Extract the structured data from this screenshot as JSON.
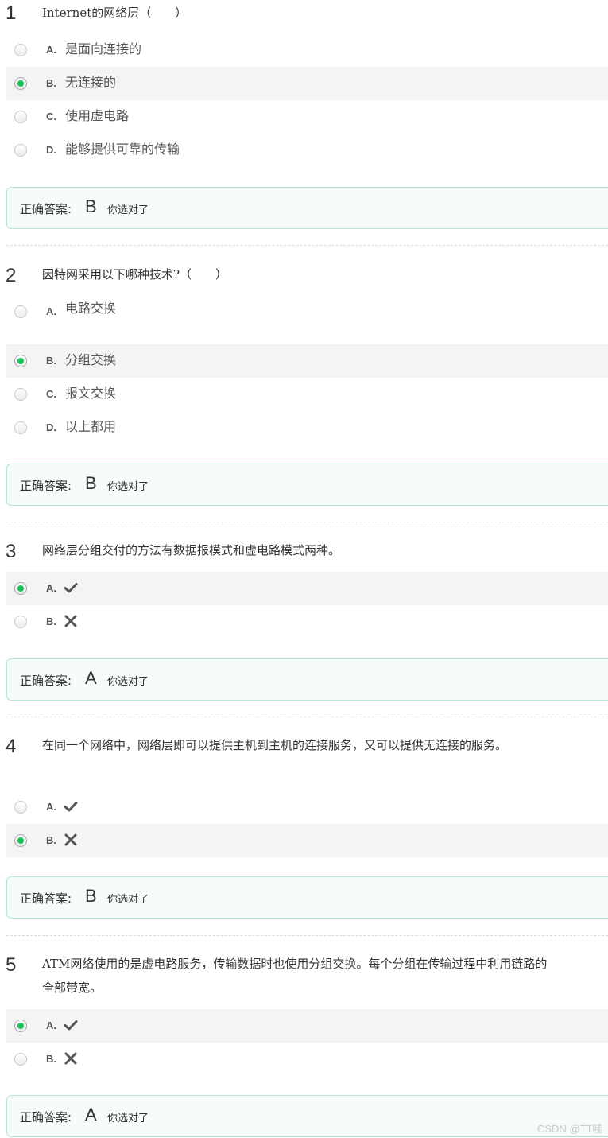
{
  "questions": [
    {
      "number": "1",
      "text": "Internet的网络层（　　）",
      "options": [
        {
          "letter": "A.",
          "text": "是面向连接的",
          "selected": false
        },
        {
          "letter": "B.",
          "text": "无连接的",
          "selected": true
        },
        {
          "letter": "C.",
          "text": "使用虚电路",
          "selected": false
        },
        {
          "letter": "D.",
          "text": "能够提供可靠的传输",
          "selected": false
        }
      ],
      "answer_label": "正确答案:",
      "answer_value": "B",
      "answer_note": "你选对了"
    },
    {
      "number": "2",
      "text": "因特网采用以下哪种技术?（　　）",
      "options": [
        {
          "letter": "A.",
          "text": "电路交换",
          "selected": false
        },
        {
          "letter": "B.",
          "text": "分组交换",
          "selected": true
        },
        {
          "letter": "C.",
          "text": "报文交换",
          "selected": false
        },
        {
          "letter": "D.",
          "text": "以上都用",
          "selected": false
        }
      ],
      "answer_label": "正确答案:",
      "answer_value": "B",
      "answer_note": "你选对了"
    },
    {
      "number": "3",
      "text": "网络层分组交付的方法有数据报模式和虚电路模式两种。",
      "options": [
        {
          "letter": "A.",
          "icon": "check-icon",
          "selected": true
        },
        {
          "letter": "B.",
          "icon": "cross-icon",
          "selected": false
        }
      ],
      "answer_label": "正确答案:",
      "answer_value": "A",
      "answer_note": "你选对了"
    },
    {
      "number": "4",
      "text": "在同一个网络中，网络层即可以提供主机到主机的连接服务，又可以提供无连接的服务。",
      "options": [
        {
          "letter": "A.",
          "icon": "check-icon",
          "selected": false
        },
        {
          "letter": "B.",
          "icon": "cross-icon",
          "selected": true
        }
      ],
      "answer_label": "正确答案:",
      "answer_value": "B",
      "answer_note": "你选对了"
    },
    {
      "number": "5",
      "text": "ATM网络使用的是虚电路服务，传输数据时也使用分组交换。每个分组在传输过程中利用链路的全部带宽。",
      "options": [
        {
          "letter": "A.",
          "icon": "check-icon",
          "selected": true
        },
        {
          "letter": "B.",
          "icon": "cross-icon",
          "selected": false
        }
      ],
      "answer_label": "正确答案:",
      "answer_value": "A",
      "answer_note": "你选对了"
    }
  ],
  "watermark": "CSDN @TT哇",
  "colors": {
    "selected_radio": "#19c359",
    "answer_border": "#b6e6cf",
    "answer_bg": "#f5fcf9"
  }
}
